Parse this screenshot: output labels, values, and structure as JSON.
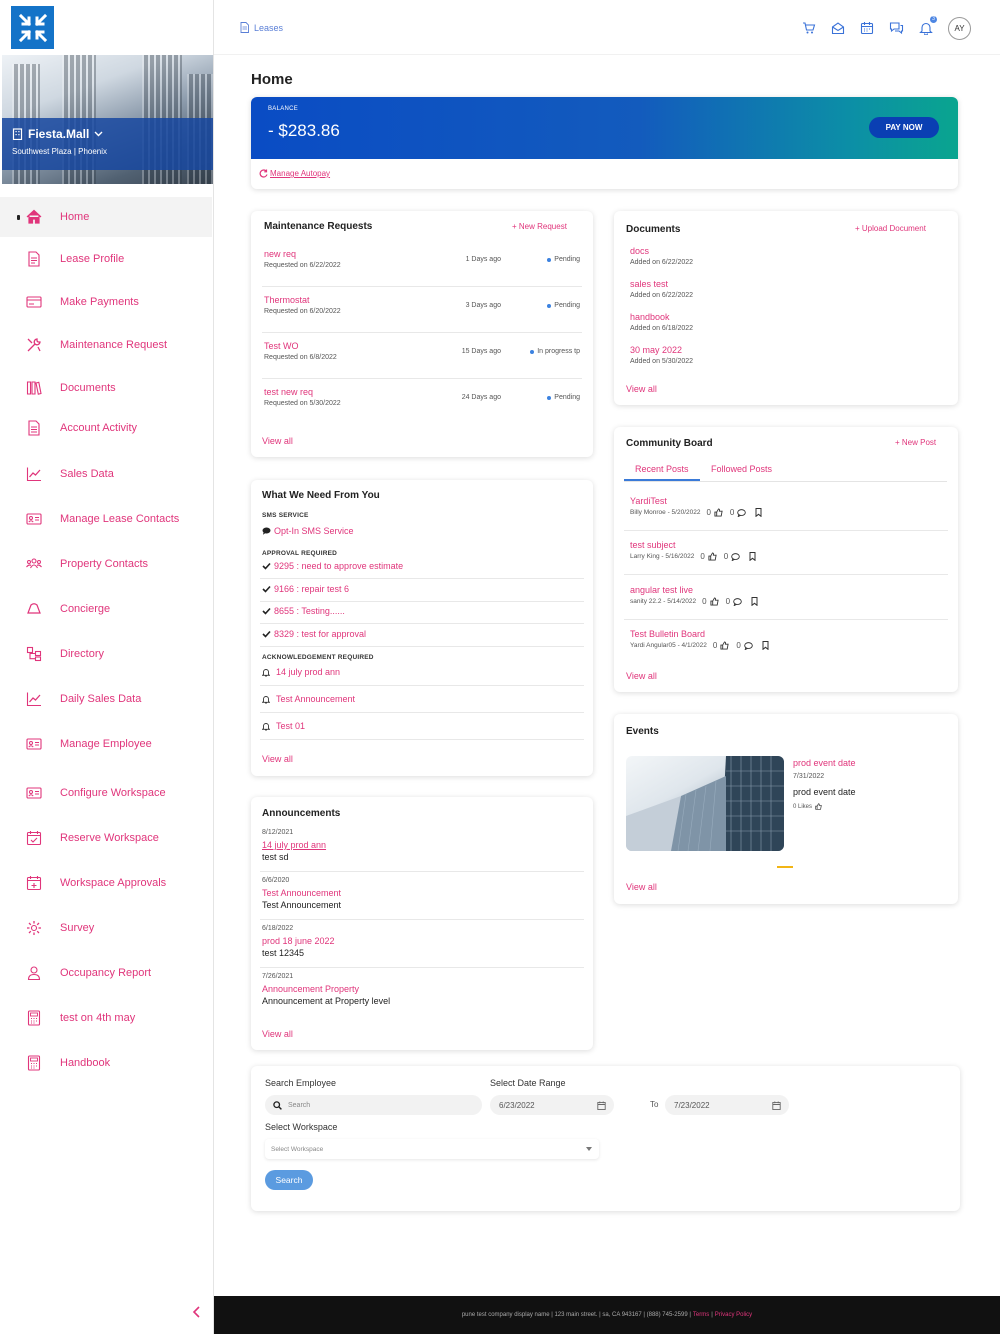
{
  "property": {
    "name": "Fiesta.Mall",
    "subtitle": "Southwest Plaza | Phoenix"
  },
  "sidebar": {
    "items": [
      {
        "label": "Home",
        "icon": "home-icon"
      },
      {
        "label": "Lease Profile",
        "icon": "document-icon"
      },
      {
        "label": "Make Payments",
        "icon": "card-icon"
      },
      {
        "label": "Maintenance Request",
        "icon": "tools-icon"
      },
      {
        "label": "Documents",
        "icon": "books-icon"
      },
      {
        "label": "Account Activity",
        "icon": "file-list-icon"
      },
      {
        "label": "Sales Data",
        "icon": "chart-line-icon"
      },
      {
        "label": "Manage Lease Contacts",
        "icon": "contact-card-icon"
      },
      {
        "label": "Property Contacts",
        "icon": "people-icon"
      },
      {
        "label": "Concierge",
        "icon": "bell-icon"
      },
      {
        "label": "Directory",
        "icon": "directory-icon"
      },
      {
        "label": "Daily Sales Data",
        "icon": "chart-line-icon"
      },
      {
        "label": "Manage Employee",
        "icon": "contact-card-icon"
      },
      {
        "label": "Configure Workspace",
        "icon": "contact-card-icon"
      },
      {
        "label": "Reserve Workspace",
        "icon": "calendar-check-icon"
      },
      {
        "label": "Workspace Approvals",
        "icon": "calendar-plus-icon"
      },
      {
        "label": "Survey",
        "icon": "gear-icon"
      },
      {
        "label": "Occupancy Report",
        "icon": "user-icon"
      },
      {
        "label": "test on 4th may",
        "icon": "calculator-icon"
      },
      {
        "label": "Handbook",
        "icon": "calculator-icon"
      }
    ]
  },
  "topbar": {
    "breadcrumb": "Leases",
    "notification_count": "3",
    "avatar_initials": "AY"
  },
  "page": {
    "title": "Home"
  },
  "balance": {
    "label": "BALANCE",
    "value": "- $283.86",
    "pay_label": "PAY NOW",
    "autopay_label": "Manage Autopay"
  },
  "maintenance": {
    "title": "Maintenance Requests",
    "new_label": "+ New Request",
    "rows": [
      {
        "title": "new req",
        "sub": "Requested on 6/22/2022",
        "ago": "1 Days ago",
        "status": "Pending"
      },
      {
        "title": "Thermostat",
        "sub": "Requested on 6/20/2022",
        "ago": "3 Days ago",
        "status": "Pending"
      },
      {
        "title": "Test WO",
        "sub": "Requested on 6/8/2022",
        "ago": "15 Days ago",
        "status": "In progress tp"
      },
      {
        "title": "test new req",
        "sub": "Requested on 5/30/2022",
        "ago": "24 Days ago",
        "status": "Pending"
      }
    ],
    "view_all": "View all"
  },
  "documents": {
    "title": "Documents",
    "upload_label": "+ Upload Document",
    "rows": [
      {
        "title": "docs",
        "sub": "Added on 6/22/2022"
      },
      {
        "title": "sales test",
        "sub": "Added on 6/22/2022"
      },
      {
        "title": "handbook",
        "sub": "Added on 6/18/2022"
      },
      {
        "title": "30 may 2022",
        "sub": "Added on 5/30/2022"
      }
    ],
    "view_all": "View all"
  },
  "needs": {
    "title": "What We Need From You",
    "sms_section": "SMS SERVICE",
    "sms_link": "Opt-In SMS Service",
    "approval_section": "APPROVAL REQUIRED",
    "approvals": [
      "9295 : need to approve estimate",
      "9166 : repair test 6",
      "8655 : Testing......",
      "8329 : test for approval"
    ],
    "ack_section": "ACKNOWLEDGEMENT REQUIRED",
    "acks": [
      "14 july prod ann",
      "Test Announcement",
      "Test 01"
    ],
    "view_all": "View all"
  },
  "community": {
    "title": "Community Board",
    "new_label": "+ New Post",
    "tabs": [
      "Recent Posts",
      "Followed Posts"
    ],
    "posts": [
      {
        "title": "YardiTest",
        "meta": "Billy Monroe - 5/20/2022",
        "likes": "0",
        "comments": "0"
      },
      {
        "title": "test subject",
        "meta": "Larry King - 5/16/2022",
        "likes": "0",
        "comments": "0"
      },
      {
        "title": "angular test live",
        "meta": "sanity 22.2 - 5/14/2022",
        "likes": "0",
        "comments": "0"
      },
      {
        "title": "Test Bulletin Board",
        "meta": "Yardi Angular05 - 4/1/2022",
        "likes": "0",
        "comments": "0"
      }
    ],
    "view_all": "View all"
  },
  "announcements": {
    "title": "Announcements",
    "items": [
      {
        "date": "8/12/2021",
        "title": "14 july prod ann",
        "desc": "test sd"
      },
      {
        "date": "6/6/2020",
        "title": "Test Announcement",
        "desc": "Test Announcement"
      },
      {
        "date": "6/18/2022",
        "title": "prod 18 june 2022",
        "desc": "test 12345"
      },
      {
        "date": "7/26/2021",
        "title": "Announcement Property",
        "desc": "Announcement at Property level"
      }
    ],
    "view_all": "View all"
  },
  "events": {
    "title": "Events",
    "item": {
      "title": "prod event date",
      "date": "7/31/2022",
      "desc": "prod event date",
      "likes": "0 Likes"
    },
    "view_all": "View all"
  },
  "search": {
    "employee_label": "Search Employee",
    "employee_placeholder": "Search",
    "date_label": "Select Date Range",
    "date_from": "6/23/2022",
    "to_label": "To",
    "date_to": "7/23/2022",
    "workspace_label": "Select Workspace",
    "workspace_placeholder": "Select Workspace",
    "button": "Search"
  },
  "footer": {
    "text": "pune test company display name | 123 main street. | sa, CA 943167 | (888) 745-2599 |",
    "terms": "Terms",
    "sep": "|",
    "privacy": "Privacy Policy"
  },
  "colors": {
    "accent": "#e0357b",
    "primary": "#0a4cc4",
    "status_dot": "#3c82e0"
  }
}
